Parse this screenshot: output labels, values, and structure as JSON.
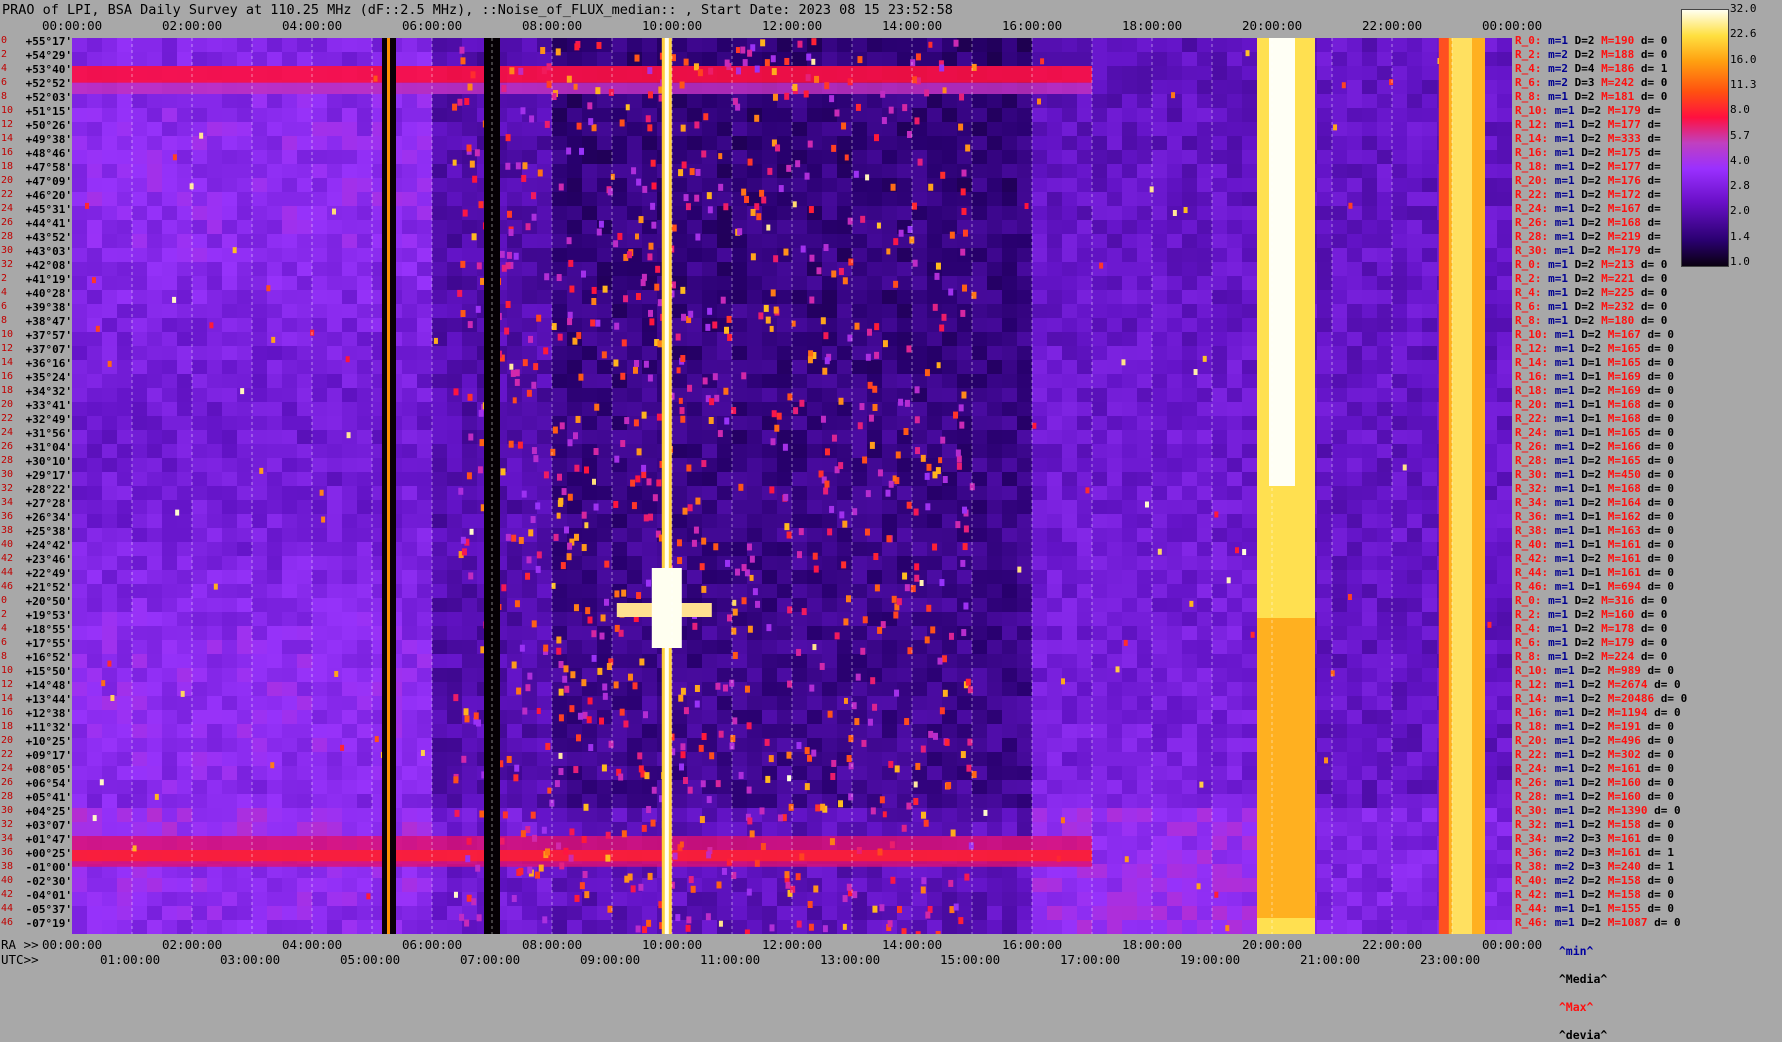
{
  "title": "PRAO of LPI, BSA Daily Survey at 110.25 MHz (dF::2.5 MHz), ::Noise_of_FLUX_median:: , Start Date: 2023 08 15 23:52:58",
  "top_time_labels": [
    "00:00:00",
    "02:00:00",
    "04:00:00",
    "06:00:00",
    "08:00:00",
    "10:00:00",
    "12:00:00",
    "14:00:00",
    "16:00:00",
    "18:00:00",
    "20:00:00",
    "22:00:00",
    "00:00:00"
  ],
  "ra_prefix": "RA >>",
  "ra_labels": [
    "00:00:00",
    "02:00:00",
    "04:00:00",
    "06:00:00",
    "08:00:00",
    "10:00:00",
    "12:00:00",
    "14:00:00",
    "16:00:00",
    "18:00:00",
    "20:00:00",
    "22:00:00",
    "00:00:00"
  ],
  "utc_prefix": "UTC>>",
  "utc_labels": [
    "01:00:00",
    "03:00:00",
    "05:00:00",
    "07:00:00",
    "09:00:00",
    "11:00:00",
    "13:00:00",
    "15:00:00",
    "17:00:00",
    "19:00:00",
    "21:00:00",
    "23:00:00"
  ],
  "declinations": [
    {
      "i": "0",
      "d": "+55°17'"
    },
    {
      "i": "2",
      "d": "+54°29'"
    },
    {
      "i": "4",
      "d": "+53°40'"
    },
    {
      "i": "6",
      "d": "+52°52'"
    },
    {
      "i": "8",
      "d": "+52°03'"
    },
    {
      "i": "10",
      "d": "+51°15'"
    },
    {
      "i": "12",
      "d": "+50°26'"
    },
    {
      "i": "14",
      "d": "+49°38'"
    },
    {
      "i": "16",
      "d": "+48°46'"
    },
    {
      "i": "18",
      "d": "+47°58'"
    },
    {
      "i": "20",
      "d": "+47°09'"
    },
    {
      "i": "22",
      "d": "+46°20'"
    },
    {
      "i": "24",
      "d": "+45°31'"
    },
    {
      "i": "26",
      "d": "+44°41'"
    },
    {
      "i": "28",
      "d": "+43°52'"
    },
    {
      "i": "30",
      "d": "+43°03'"
    },
    {
      "i": "32",
      "d": "+42°08'"
    },
    {
      "i": "2",
      "d": "+41°19'"
    },
    {
      "i": "4",
      "d": "+40°28'"
    },
    {
      "i": "6",
      "d": "+39°38'"
    },
    {
      "i": "8",
      "d": "+38°47'"
    },
    {
      "i": "10",
      "d": "+37°57'"
    },
    {
      "i": "12",
      "d": "+37°07'"
    },
    {
      "i": "14",
      "d": "+36°16'"
    },
    {
      "i": "16",
      "d": "+35°24'"
    },
    {
      "i": "18",
      "d": "+34°32'"
    },
    {
      "i": "20",
      "d": "+33°41'"
    },
    {
      "i": "22",
      "d": "+32°49'"
    },
    {
      "i": "24",
      "d": "+31°56'"
    },
    {
      "i": "26",
      "d": "+31°04'"
    },
    {
      "i": "28",
      "d": "+30°10'"
    },
    {
      "i": "30",
      "d": "+29°17'"
    },
    {
      "i": "32",
      "d": "+28°22'"
    },
    {
      "i": "34",
      "d": "+27°28'"
    },
    {
      "i": "36",
      "d": "+26°34'"
    },
    {
      "i": "38",
      "d": "+25°38'"
    },
    {
      "i": "40",
      "d": "+24°42'"
    },
    {
      "i": "42",
      "d": "+23°46'"
    },
    {
      "i": "44",
      "d": "+22°49'"
    },
    {
      "i": "46",
      "d": "+21°52'"
    },
    {
      "i": "0",
      "d": "+20°50'"
    },
    {
      "i": "2",
      "d": "+19°53'"
    },
    {
      "i": "4",
      "d": "+18°55'"
    },
    {
      "i": "6",
      "d": "+17°55'"
    },
    {
      "i": "8",
      "d": "+16°52'"
    },
    {
      "i": "10",
      "d": "+15°50'"
    },
    {
      "i": "12",
      "d": "+14°48'"
    },
    {
      "i": "14",
      "d": "+13°44'"
    },
    {
      "i": "16",
      "d": "+12°38'"
    },
    {
      "i": "18",
      "d": "+11°32'"
    },
    {
      "i": "20",
      "d": "+10°25'"
    },
    {
      "i": "22",
      "d": "+09°17'"
    },
    {
      "i": "24",
      "d": "+08°05'"
    },
    {
      "i": "26",
      "d": "+06°54'"
    },
    {
      "i": "28",
      "d": "+05°41'"
    },
    {
      "i": "30",
      "d": "+04°25'"
    },
    {
      "i": "32",
      "d": "+03°07'"
    },
    {
      "i": "34",
      "d": "+01°47'"
    },
    {
      "i": "36",
      "d": "+00°25'"
    },
    {
      "i": "38",
      "d": "-01°00'"
    },
    {
      "i": "40",
      "d": "-02°30'"
    },
    {
      "i": "42",
      "d": "-04°01'"
    },
    {
      "i": "44",
      "d": "-05°37'"
    },
    {
      "i": "46",
      "d": "-07°19'"
    }
  ],
  "stats": [
    {
      "r": "R_0:",
      "m": "m=1",
      "D": "D=2",
      "M": "M=190",
      "d": "d= 0"
    },
    {
      "r": "R_2:",
      "m": "m=2",
      "D": "D=2",
      "M": "M=188",
      "d": "d= 0"
    },
    {
      "r": "R_4:",
      "m": "m=2",
      "D": "D=4",
      "M": "M=186",
      "d": "d= 1"
    },
    {
      "r": "R_6:",
      "m": "m=2",
      "D": "D=3",
      "M": "M=242",
      "d": "d= 0"
    },
    {
      "r": "R_8:",
      "m": "m=1",
      "D": "D=2",
      "M": "M=181",
      "d": "d= 0"
    },
    {
      "r": "R_10:",
      "m": "m=1",
      "D": "D=2",
      "M": "M=179",
      "d": "d="
    },
    {
      "r": "R_12:",
      "m": "m=1",
      "D": "D=2",
      "M": "M=177",
      "d": "d="
    },
    {
      "r": "R_14:",
      "m": "m=1",
      "D": "D=2",
      "M": "M=333",
      "d": "d="
    },
    {
      "r": "R_16:",
      "m": "m=1",
      "D": "D=2",
      "M": "M=175",
      "d": "d="
    },
    {
      "r": "R_18:",
      "m": "m=1",
      "D": "D=2",
      "M": "M=177",
      "d": "d="
    },
    {
      "r": "R_20:",
      "m": "m=1",
      "D": "D=2",
      "M": "M=176",
      "d": "d="
    },
    {
      "r": "R_22:",
      "m": "m=1",
      "D": "D=2",
      "M": "M=172",
      "d": "d="
    },
    {
      "r": "R_24:",
      "m": "m=1",
      "D": "D=2",
      "M": "M=167",
      "d": "d="
    },
    {
      "r": "R_26:",
      "m": "m=1",
      "D": "D=2",
      "M": "M=168",
      "d": "d="
    },
    {
      "r": "R_28:",
      "m": "m=1",
      "D": "D=2",
      "M": "M=219",
      "d": "d="
    },
    {
      "r": "R_30:",
      "m": "m=1",
      "D": "D=2",
      "M": "M=179",
      "d": "d="
    },
    {
      "r": "R_0:",
      "m": "m=1",
      "D": "D=2",
      "M": "M=213",
      "d": "d= 0"
    },
    {
      "r": "R_2:",
      "m": "m=1",
      "D": "D=2",
      "M": "M=221",
      "d": "d= 0"
    },
    {
      "r": "R_4:",
      "m": "m=1",
      "D": "D=2",
      "M": "M=225",
      "d": "d= 0"
    },
    {
      "r": "R_6:",
      "m": "m=1",
      "D": "D=2",
      "M": "M=232",
      "d": "d= 0"
    },
    {
      "r": "R_8:",
      "m": "m=1",
      "D": "D=2",
      "M": "M=180",
      "d": "d= 0"
    },
    {
      "r": "R_10:",
      "m": "m=1",
      "D": "D=2",
      "M": "M=167",
      "d": "d= 0"
    },
    {
      "r": "R_12:",
      "m": "m=1",
      "D": "D=2",
      "M": "M=165",
      "d": "d= 0"
    },
    {
      "r": "R_14:",
      "m": "m=1",
      "D": "D=1",
      "M": "M=165",
      "d": "d= 0"
    },
    {
      "r": "R_16:",
      "m": "m=1",
      "D": "D=1",
      "M": "M=169",
      "d": "d= 0"
    },
    {
      "r": "R_18:",
      "m": "m=1",
      "D": "D=2",
      "M": "M=169",
      "d": "d= 0"
    },
    {
      "r": "R_20:",
      "m": "m=1",
      "D": "D=1",
      "M": "M=168",
      "d": "d= 0"
    },
    {
      "r": "R_22:",
      "m": "m=1",
      "D": "D=1",
      "M": "M=168",
      "d": "d= 0"
    },
    {
      "r": "R_24:",
      "m": "m=1",
      "D": "D=1",
      "M": "M=165",
      "d": "d= 0"
    },
    {
      "r": "R_26:",
      "m": "m=1",
      "D": "D=2",
      "M": "M=166",
      "d": "d= 0"
    },
    {
      "r": "R_28:",
      "m": "m=1",
      "D": "D=2",
      "M": "M=165",
      "d": "d= 0"
    },
    {
      "r": "R_30:",
      "m": "m=1",
      "D": "D=2",
      "M": "M=450",
      "d": "d= 0"
    },
    {
      "r": "R_32:",
      "m": "m=1",
      "D": "D=1",
      "M": "M=168",
      "d": "d= 0"
    },
    {
      "r": "R_34:",
      "m": "m=1",
      "D": "D=2",
      "M": "M=164",
      "d": "d= 0"
    },
    {
      "r": "R_36:",
      "m": "m=1",
      "D": "D=1",
      "M": "M=162",
      "d": "d= 0"
    },
    {
      "r": "R_38:",
      "m": "m=1",
      "D": "D=1",
      "M": "M=163",
      "d": "d= 0"
    },
    {
      "r": "R_40:",
      "m": "m=1",
      "D": "D=1",
      "M": "M=161",
      "d": "d= 0"
    },
    {
      "r": "R_42:",
      "m": "m=1",
      "D": "D=2",
      "M": "M=161",
      "d": "d= 0"
    },
    {
      "r": "R_44:",
      "m": "m=1",
      "D": "D=1",
      "M": "M=161",
      "d": "d= 0"
    },
    {
      "r": "R_46:",
      "m": "m=1",
      "D": "D=1",
      "M": "M=694",
      "d": "d= 0"
    },
    {
      "r": "R_0:",
      "m": "m=1",
      "D": "D=2",
      "M": "M=316",
      "d": "d= 0"
    },
    {
      "r": "R_2:",
      "m": "m=1",
      "D": "D=2",
      "M": "M=160",
      "d": "d= 0"
    },
    {
      "r": "R_4:",
      "m": "m=1",
      "D": "D=2",
      "M": "M=178",
      "d": "d= 0"
    },
    {
      "r": "R_6:",
      "m": "m=1",
      "D": "D=2",
      "M": "M=179",
      "d": "d= 0"
    },
    {
      "r": "R_8:",
      "m": "m=1",
      "D": "D=2",
      "M": "M=224",
      "d": "d= 0"
    },
    {
      "r": "R_10:",
      "m": "m=1",
      "D": "D=2",
      "M": "M=989",
      "d": "d= 0"
    },
    {
      "r": "R_12:",
      "m": "m=1",
      "D": "D=2",
      "M": "M=2674",
      "d": "d= 0"
    },
    {
      "r": "R_14:",
      "m": "m=1",
      "D": "D=2",
      "M": "M=20486",
      "d": "d= 0"
    },
    {
      "r": "R_16:",
      "m": "m=1",
      "D": "D=2",
      "M": "M=1194",
      "d": "d= 0"
    },
    {
      "r": "R_18:",
      "m": "m=1",
      "D": "D=2",
      "M": "M=191",
      "d": "d= 0"
    },
    {
      "r": "R_20:",
      "m": "m=1",
      "D": "D=2",
      "M": "M=496",
      "d": "d= 0"
    },
    {
      "r": "R_22:",
      "m": "m=1",
      "D": "D=2",
      "M": "M=302",
      "d": "d= 0"
    },
    {
      "r": "R_24:",
      "m": "m=1",
      "D": "D=2",
      "M": "M=161",
      "d": "d= 0"
    },
    {
      "r": "R_26:",
      "m": "m=1",
      "D": "D=2",
      "M": "M=160",
      "d": "d= 0"
    },
    {
      "r": "R_28:",
      "m": "m=1",
      "D": "D=2",
      "M": "M=160",
      "d": "d= 0"
    },
    {
      "r": "R_30:",
      "m": "m=1",
      "D": "D=2",
      "M": "M=1390",
      "d": "d= 0"
    },
    {
      "r": "R_32:",
      "m": "m=1",
      "D": "D=2",
      "M": "M=158",
      "d": "d= 0"
    },
    {
      "r": "R_34:",
      "m": "m=2",
      "D": "D=3",
      "M": "M=161",
      "d": "d= 0"
    },
    {
      "r": "R_36:",
      "m": "m=2",
      "D": "D=3",
      "M": "M=161",
      "d": "d= 1"
    },
    {
      "r": "R_38:",
      "m": "m=2",
      "D": "D=3",
      "M": "M=240",
      "d": "d= 1"
    },
    {
      "r": "R_40:",
      "m": "m=2",
      "D": "D=2",
      "M": "M=158",
      "d": "d= 0"
    },
    {
      "r": "R_42:",
      "m": "m=1",
      "D": "D=2",
      "M": "M=158",
      "d": "d= 0"
    },
    {
      "r": "R_44:",
      "m": "m=1",
      "D": "D=1",
      "M": "M=155",
      "d": "d= 0"
    },
    {
      "r": "R_46:",
      "m": "m=1",
      "D": "D=2",
      "M": "M=1087",
      "d": "d= 0"
    }
  ],
  "colorbar_ticks": [
    "32.0",
    "22.6",
    "16.0",
    "11.3",
    "8.0",
    "5.7",
    "4.0",
    "2.8",
    "2.0",
    "1.4",
    "1.0"
  ],
  "legend": {
    "min": "^min^",
    "median": "^Media^",
    "max": "^Max^",
    "devia": "^devia^"
  },
  "colors": {
    "background": "#a8a8a8",
    "min": "#0000a0",
    "median": "#000000",
    "max": "#ff1010",
    "devia": "#000000"
  },
  "chart_data": {
    "type": "heatmap",
    "title": "PRAO of LPI, BSA Daily Survey at 110.25 MHz (dF::2.5 MHz), ::Noise_of_FLUX_median:: , Start Date: 2023 08 15 23:52:58",
    "x_axis": "RA / UTC, 00:00:00 to 00:00:00 (24 h)",
    "y_axis": "declination, +55°17' to -07°19' (64 beams)",
    "colorscale_range": [
      1.0,
      32.0
    ],
    "features": [
      {
        "kind": "bright vertical source track",
        "ra_start": "09:40",
        "ra_end": "10:00"
      },
      {
        "kind": "saturated interference band",
        "ra_start": "19:50",
        "ra_end": "20:50"
      },
      {
        "kind": "saturated interference band",
        "ra_start": "22:50",
        "ra_end": "23:40"
      },
      {
        "kind": "strong horizontal band",
        "dec": "+53°40'"
      },
      {
        "kind": "strong horizontal band",
        "dec": "-01°00'"
      }
    ]
  }
}
